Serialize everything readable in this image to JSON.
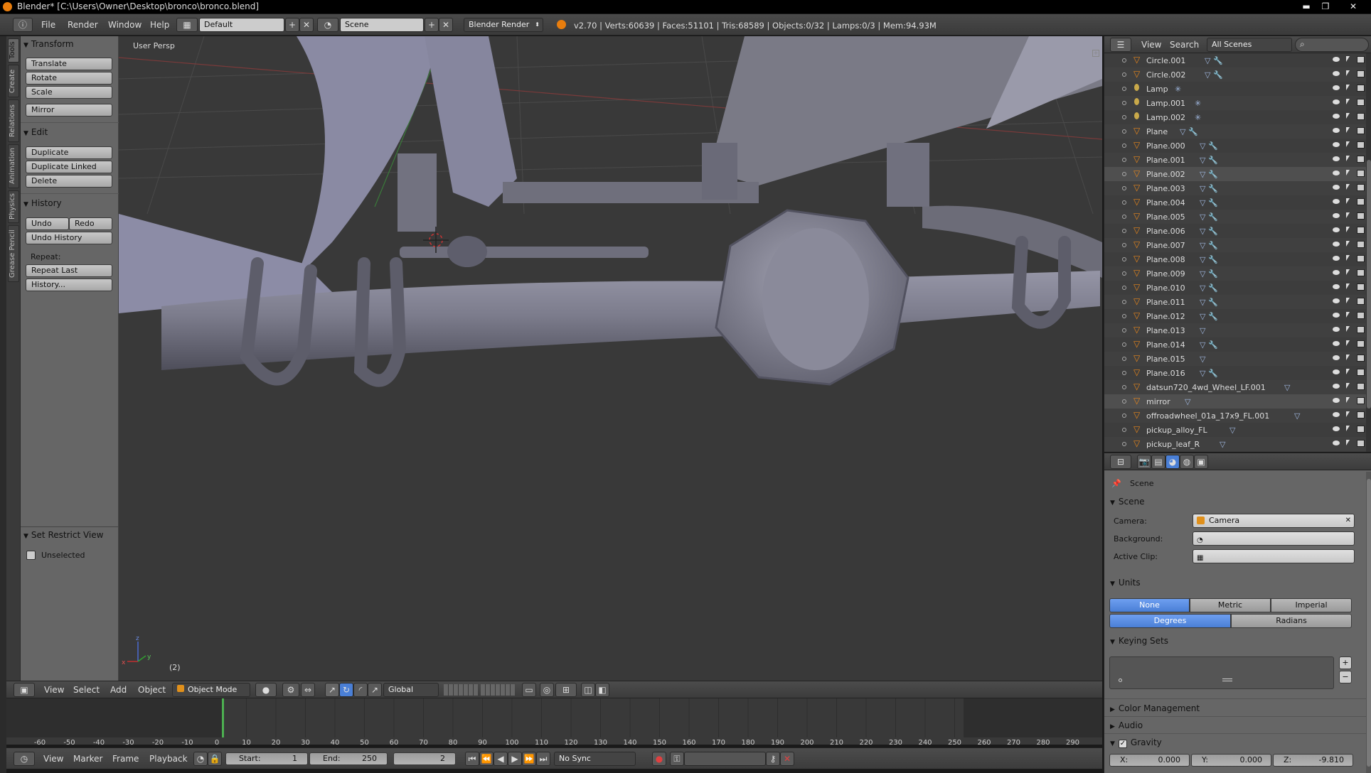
{
  "titlebar": {
    "title": "Blender* [C:\\Users\\Owner\\Desktop\\bronco\\bronco.blend]",
    "minimize": "▬",
    "restore": "❐",
    "close": "✕"
  },
  "infobar": {
    "menus": [
      "File",
      "Render",
      "Window",
      "Help"
    ],
    "layout": "Default",
    "scene": "Scene",
    "engine": "Blender Render",
    "stats": "v2.70 | Verts:60639 | Faces:51101 | Tris:68589 | Objects:0/32 | Lamps:0/3 | Mem:94.93M"
  },
  "lefttabs": [
    "Tools",
    "Create",
    "Relations",
    "Animation",
    "Physics",
    "Grease Pencil"
  ],
  "toolshelf": {
    "transform": {
      "header": "Transform",
      "buttons": [
        "Translate",
        "Rotate",
        "Scale",
        "Mirror"
      ]
    },
    "edit": {
      "header": "Edit",
      "buttons": [
        "Duplicate",
        "Duplicate Linked",
        "Delete"
      ]
    },
    "history": {
      "header": "History",
      "undo": "Undo",
      "redo": "Redo",
      "undo_history": "Undo History",
      "repeat_label": "Repeat:",
      "repeat_last": "Repeat Last",
      "history_btn": "History..."
    },
    "restrict": {
      "header": "Set Restrict View",
      "checkbox": "Unselected"
    }
  },
  "viewport": {
    "label": "User Persp",
    "frame": "(2)"
  },
  "vpheader": {
    "menus": [
      "View",
      "Select",
      "Add",
      "Object"
    ],
    "mode": "Object Mode",
    "orientation": "Global"
  },
  "timeline": {
    "ticks": [
      "-60",
      "-50",
      "-40",
      "-30",
      "-20",
      "-10",
      "0",
      "10",
      "20",
      "30",
      "40",
      "50",
      "60",
      "70",
      "80",
      "90",
      "100",
      "110",
      "120",
      "130",
      "140",
      "150",
      "160",
      "170",
      "180",
      "190",
      "200",
      "210",
      "220",
      "230",
      "240",
      "250",
      "260",
      "270",
      "280",
      "290"
    ],
    "current_frame": 2
  },
  "tlheader": {
    "menus": [
      "View",
      "Marker",
      "Frame",
      "Playback"
    ],
    "start_label": "Start:",
    "start": "1",
    "end_label": "End:",
    "end": "250",
    "current": "2",
    "sync": "No Sync"
  },
  "outliner": {
    "menus": [
      "View",
      "Search"
    ],
    "scenes": "All Scenes",
    "rows": [
      {
        "name": "Circle.001",
        "type": "mesh",
        "mods": "▽ 🔧"
      },
      {
        "name": "Circle.002",
        "type": "mesh",
        "mods": "▽ 🔧"
      },
      {
        "name": "Lamp",
        "type": "lamp",
        "mods": "✳"
      },
      {
        "name": "Lamp.001",
        "type": "lamp",
        "mods": "✳"
      },
      {
        "name": "Lamp.002",
        "type": "lamp",
        "mods": "✳"
      },
      {
        "name": "Plane",
        "type": "mesh",
        "mods": "▽ 🔧"
      },
      {
        "name": "Plane.000",
        "type": "mesh",
        "mods": "▽ 🔧"
      },
      {
        "name": "Plane.001",
        "type": "mesh",
        "mods": "▽ 🔧"
      },
      {
        "name": "Plane.002",
        "type": "mesh",
        "mods": "▽ 🔧"
      },
      {
        "name": "Plane.003",
        "type": "mesh",
        "mods": "▽ 🔧"
      },
      {
        "name": "Plane.004",
        "type": "mesh",
        "mods": "▽ 🔧"
      },
      {
        "name": "Plane.005",
        "type": "mesh",
        "mods": "▽ 🔧"
      },
      {
        "name": "Plane.006",
        "type": "mesh",
        "mods": "▽ 🔧"
      },
      {
        "name": "Plane.007",
        "type": "mesh",
        "mods": "▽ 🔧"
      },
      {
        "name": "Plane.008",
        "type": "mesh",
        "mods": "▽ 🔧"
      },
      {
        "name": "Plane.009",
        "type": "mesh",
        "mods": "▽ 🔧"
      },
      {
        "name": "Plane.010",
        "type": "mesh",
        "mods": "▽ 🔧"
      },
      {
        "name": "Plane.011",
        "type": "mesh",
        "mods": "▽ 🔧"
      },
      {
        "name": "Plane.012",
        "type": "mesh",
        "mods": "▽ 🔧"
      },
      {
        "name": "Plane.013",
        "type": "mesh",
        "mods": "▽"
      },
      {
        "name": "Plane.014",
        "type": "mesh",
        "mods": "▽ 🔧"
      },
      {
        "name": "Plane.015",
        "type": "mesh",
        "mods": "▽"
      },
      {
        "name": "Plane.016",
        "type": "mesh",
        "mods": "▽ 🔧"
      },
      {
        "name": "datsun720_4wd_Wheel_LF.001",
        "type": "mesh",
        "mods": "▽"
      },
      {
        "name": "mirror",
        "type": "mesh",
        "mods": "▽"
      },
      {
        "name": "offroadwheel_01a_17x9_FL.001",
        "type": "mesh",
        "mods": "▽"
      },
      {
        "name": "pickup_alloy_FL",
        "type": "mesh",
        "mods": "▽"
      },
      {
        "name": "pickup_leaf_R",
        "type": "mesh",
        "mods": "▽"
      }
    ]
  },
  "properties": {
    "breadcrumb": "Scene",
    "scene_header": "Scene",
    "camera_label": "Camera:",
    "camera": "Camera",
    "background_label": "Background:",
    "clip_label": "Active Clip:",
    "units_header": "Units",
    "units": [
      "None",
      "Metric",
      "Imperial"
    ],
    "angles": [
      "Degrees",
      "Radians"
    ],
    "keying_header": "Keying Sets",
    "color_mgmt": "Color Management",
    "audio": "Audio",
    "gravity": "Gravity",
    "gx_label": "X:",
    "gx": "0.000",
    "gy_label": "Y:",
    "gy": "0.000",
    "gz_label": "Z:",
    "gz": "-9.810"
  }
}
